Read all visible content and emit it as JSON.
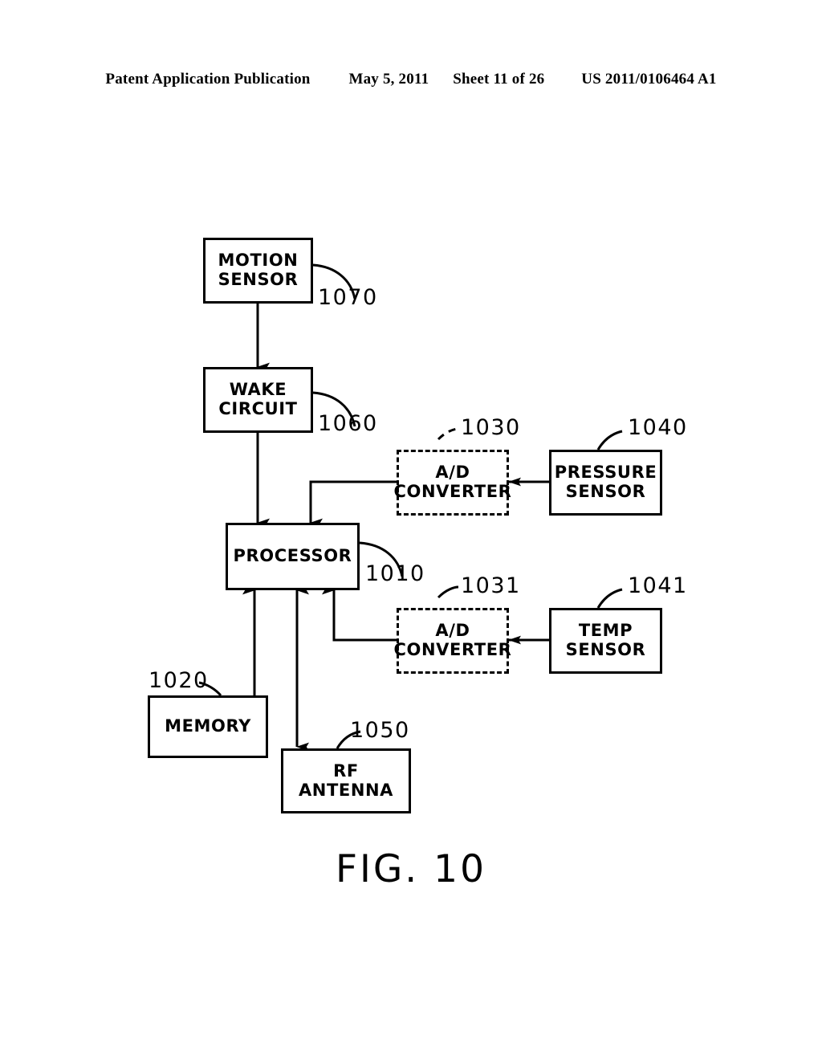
{
  "header": {
    "publication": "Patent Application Publication",
    "date": "May 5, 2011",
    "sheet": "Sheet 11 of 26",
    "doc_number": "US 2011/0106464 A1"
  },
  "figure": {
    "caption": "FIG.  10",
    "blocks": [
      {
        "id": "motion-sensor",
        "label": "MOTION\nSENSOR",
        "ref": "1070",
        "style": "solid"
      },
      {
        "id": "wake-circuit",
        "label": "WAKE\nCIRCUIT",
        "ref": "1060",
        "style": "solid"
      },
      {
        "id": "ad-converter-1",
        "label": "A/D\nCONVERTER",
        "ref": "1030",
        "style": "dashed"
      },
      {
        "id": "pressure-sensor",
        "label": "PRESSURE\nSENSOR",
        "ref": "1040",
        "style": "solid"
      },
      {
        "id": "processor",
        "label": "PROCESSOR",
        "ref": "1010",
        "style": "solid"
      },
      {
        "id": "ad-converter-2",
        "label": "A/D\nCONVERTER",
        "ref": "1031",
        "style": "dashed"
      },
      {
        "id": "temp-sensor",
        "label": "TEMP\nSENSOR",
        "ref": "1041",
        "style": "solid"
      },
      {
        "id": "memory",
        "label": "MEMORY",
        "ref": "1020",
        "style": "solid"
      },
      {
        "id": "rf-antenna",
        "label": "RF  ANTENNA",
        "ref": "1050",
        "style": "solid"
      }
    ],
    "block_text": {
      "motion_sensor_line1": "MOTION",
      "motion_sensor_line2": "SENSOR",
      "wake_circuit_line1": "WAKE",
      "wake_circuit_line2": "CIRCUIT",
      "ad_converter_line1": "A/D",
      "ad_converter_line2": "CONVERTER",
      "pressure_sensor_line1": "PRESSURE",
      "pressure_sensor_line2": "SENSOR",
      "processor": "PROCESSOR",
      "temp_sensor_line1": "TEMP",
      "temp_sensor_line2": "SENSOR",
      "memory": "MEMORY",
      "rf_antenna": "RF  ANTENNA"
    },
    "ref_numbers": {
      "motion_sensor": "1070",
      "wake_circuit": "1060",
      "ad_converter_1": "1030",
      "pressure_sensor": "1040",
      "processor": "1010",
      "ad_converter_2": "1031",
      "temp_sensor": "1041",
      "memory": "1020",
      "rf_antenna": "1050"
    },
    "connections": [
      {
        "from": "motion-sensor",
        "to": "wake-circuit",
        "direction": "down"
      },
      {
        "from": "wake-circuit",
        "to": "processor",
        "direction": "down"
      },
      {
        "from": "pressure-sensor",
        "to": "ad-converter-1",
        "direction": "left"
      },
      {
        "from": "ad-converter-1",
        "to": "processor",
        "direction": "down"
      },
      {
        "from": "temp-sensor",
        "to": "ad-converter-2",
        "direction": "left"
      },
      {
        "from": "ad-converter-2",
        "to": "processor",
        "direction": "up"
      },
      {
        "from": "memory",
        "to": "processor",
        "direction": "up"
      },
      {
        "from": "processor",
        "to": "rf-antenna",
        "direction": "bidirectional"
      }
    ],
    "colors": {
      "ink": "#000000",
      "paper": "#ffffff"
    }
  }
}
